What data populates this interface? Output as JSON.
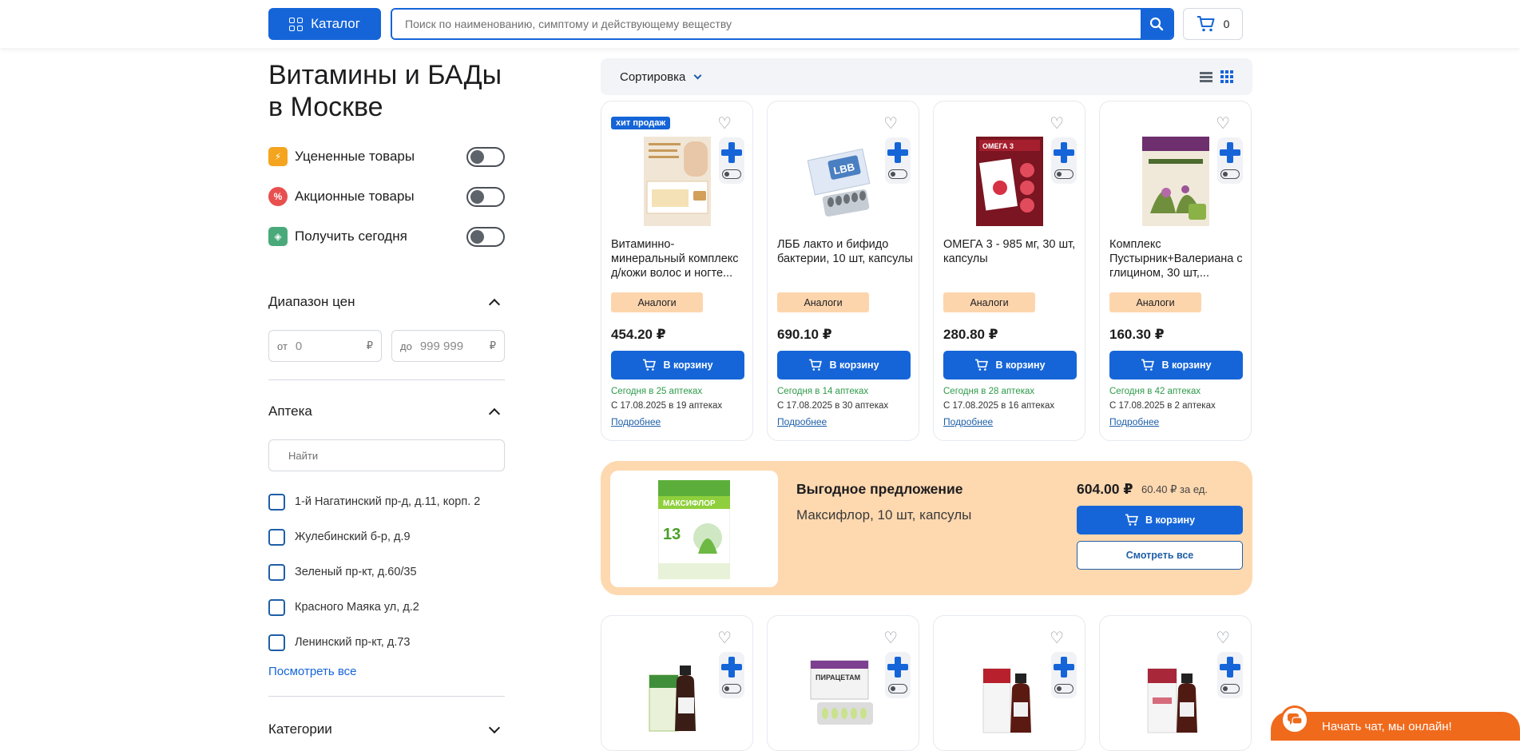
{
  "header": {
    "catalog_label": "Каталог",
    "search_placeholder": "Поиск по наименованию, симптому и действующему веществу",
    "cart_count": "0"
  },
  "sidebar": {
    "title_line1": "Витамины и БАДы",
    "title_line2": "в Москве",
    "toggles": [
      {
        "label": "Уцененные товары",
        "color": "#f4a41e"
      },
      {
        "label": "Акционные товары",
        "color": "#e94f4f"
      },
      {
        "label": "Получить сегодня",
        "color": "#4aa97a"
      }
    ],
    "price_section": "Диапазон цен",
    "price_from_prefix": "от",
    "price_from_value": "0",
    "price_to_prefix": "до",
    "price_to_value": "999 999",
    "currency": "₽",
    "pharmacy_section": "Аптека",
    "pharmacy_search_placeholder": "Найти",
    "pharmacies": [
      "1-й Нагатинский пр-д, д.11, корп. 2",
      "Жулебинский б-р, д.9",
      "Зеленый пр-кт, д.60/35",
      "Красного Маяка ул, д.2",
      "Ленинский пр-кт, д.73"
    ],
    "see_all": "Посмотреть все",
    "categories_section": "Категории"
  },
  "sort": {
    "label": "Сортировка"
  },
  "products": [
    {
      "badge": "хит продаж",
      "name": "Витаминно-минеральный комплекс д/кожи волос и ногте...",
      "price": "454.20 ₽",
      "today": "Сегодня в 25 аптеках",
      "later": "С 17.08.2025 в 19 аптеках"
    },
    {
      "badge": "",
      "name": "ЛББ лакто и бифидо бактерии, 10 шт, капсулы",
      "price": "690.10 ₽",
      "today": "Сегодня в 14 аптеках",
      "later": "С 17.08.2025 в 30 аптеках"
    },
    {
      "badge": "",
      "name": "ОМЕГА 3 - 985 мг, 30 шт, капсулы",
      "price": "280.80 ₽",
      "today": "Сегодня в 28 аптеках",
      "later": "С 17.08.2025 в 16 аптеках"
    },
    {
      "badge": "",
      "name": "Комплекс Пустырник+Валериана с глицином, 30 шт,...",
      "price": "160.30 ₽",
      "today": "Сегодня в 42 аптеках",
      "later": "С 17.08.2025 в 2 аптеках"
    }
  ],
  "card_labels": {
    "analog": "Аналоги",
    "buy": "В корзину",
    "more": "Подробнее"
  },
  "promo": {
    "title": "Выгодное предложение",
    "name": "Максифлор, 10 шт, капсулы",
    "price": "604.00 ₽",
    "unit_price": "60.40 ₽ за ед.",
    "buy": "В корзину",
    "see_all": "Смотреть все",
    "pack_brand": "МАКСИФЛОР",
    "pack_number": "13"
  },
  "product_images": {
    "lbb_text": "LBB",
    "omega_text": "ОМЕГА 3",
    "piracetam_text": "ПИРАЦЕТАМ"
  },
  "chat": {
    "label": "Начать чат, мы онлайн!"
  }
}
